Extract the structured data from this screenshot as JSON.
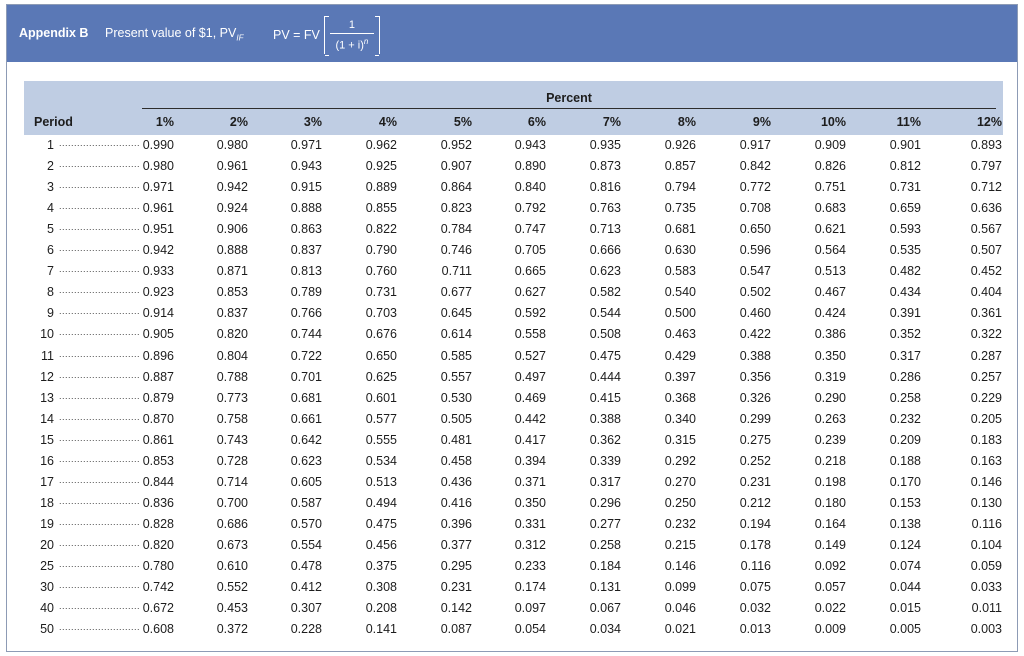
{
  "header": {
    "appendix": "Appendix B",
    "subtitle": "Present value of $1, PV",
    "subtitle_sub": "IF",
    "formula_lhs": "PV = FV",
    "formula_num": "1",
    "formula_den": "(1 + i)",
    "formula_exp": "n",
    "banner_color": "#5a78b6",
    "header_band_color": "#bfcde3"
  },
  "table": {
    "group_label": "Percent",
    "period_label": "Period",
    "columns": [
      "1%",
      "2%",
      "3%",
      "4%",
      "5%",
      "6%",
      "7%",
      "8%",
      "9%",
      "10%",
      "11%",
      "12%"
    ],
    "dots": "..............................",
    "rows": [
      {
        "period": "1",
        "values": [
          "0.990",
          "0.980",
          "0.971",
          "0.962",
          "0.952",
          "0.943",
          "0.935",
          "0.926",
          "0.917",
          "0.909",
          "0.901",
          "0.893"
        ]
      },
      {
        "period": "2",
        "values": [
          "0.980",
          "0.961",
          "0.943",
          "0.925",
          "0.907",
          "0.890",
          "0.873",
          "0.857",
          "0.842",
          "0.826",
          "0.812",
          "0.797"
        ]
      },
      {
        "period": "3",
        "values": [
          "0.971",
          "0.942",
          "0.915",
          "0.889",
          "0.864",
          "0.840",
          "0.816",
          "0.794",
          "0.772",
          "0.751",
          "0.731",
          "0.712"
        ]
      },
      {
        "period": "4",
        "values": [
          "0.961",
          "0.924",
          "0.888",
          "0.855",
          "0.823",
          "0.792",
          "0.763",
          "0.735",
          "0.708",
          "0.683",
          "0.659",
          "0.636"
        ]
      },
      {
        "period": "5",
        "values": [
          "0.951",
          "0.906",
          "0.863",
          "0.822",
          "0.784",
          "0.747",
          "0.713",
          "0.681",
          "0.650",
          "0.621",
          "0.593",
          "0.567"
        ]
      },
      {
        "period": "6",
        "values": [
          "0.942",
          "0.888",
          "0.837",
          "0.790",
          "0.746",
          "0.705",
          "0.666",
          "0.630",
          "0.596",
          "0.564",
          "0.535",
          "0.507"
        ]
      },
      {
        "period": "7",
        "values": [
          "0.933",
          "0.871",
          "0.813",
          "0.760",
          "0.711",
          "0.665",
          "0.623",
          "0.583",
          "0.547",
          "0.513",
          "0.482",
          "0.452"
        ]
      },
      {
        "period": "8",
        "values": [
          "0.923",
          "0.853",
          "0.789",
          "0.731",
          "0.677",
          "0.627",
          "0.582",
          "0.540",
          "0.502",
          "0.467",
          "0.434",
          "0.404"
        ]
      },
      {
        "period": "9",
        "values": [
          "0.914",
          "0.837",
          "0.766",
          "0.703",
          "0.645",
          "0.592",
          "0.544",
          "0.500",
          "0.460",
          "0.424",
          "0.391",
          "0.361"
        ]
      },
      {
        "period": "10",
        "values": [
          "0.905",
          "0.820",
          "0.744",
          "0.676",
          "0.614",
          "0.558",
          "0.508",
          "0.463",
          "0.422",
          "0.386",
          "0.352",
          "0.322"
        ]
      },
      {
        "period": "11",
        "values": [
          "0.896",
          "0.804",
          "0.722",
          "0.650",
          "0.585",
          "0.527",
          "0.475",
          "0.429",
          "0.388",
          "0.350",
          "0.317",
          "0.287"
        ]
      },
      {
        "period": "12",
        "values": [
          "0.887",
          "0.788",
          "0.701",
          "0.625",
          "0.557",
          "0.497",
          "0.444",
          "0.397",
          "0.356",
          "0.319",
          "0.286",
          "0.257"
        ]
      },
      {
        "period": "13",
        "values": [
          "0.879",
          "0.773",
          "0.681",
          "0.601",
          "0.530",
          "0.469",
          "0.415",
          "0.368",
          "0.326",
          "0.290",
          "0.258",
          "0.229"
        ]
      },
      {
        "period": "14",
        "values": [
          "0.870",
          "0.758",
          "0.661",
          "0.577",
          "0.505",
          "0.442",
          "0.388",
          "0.340",
          "0.299",
          "0.263",
          "0.232",
          "0.205"
        ]
      },
      {
        "period": "15",
        "values": [
          "0.861",
          "0.743",
          "0.642",
          "0.555",
          "0.481",
          "0.417",
          "0.362",
          "0.315",
          "0.275",
          "0.239",
          "0.209",
          "0.183"
        ]
      },
      {
        "period": "16",
        "values": [
          "0.853",
          "0.728",
          "0.623",
          "0.534",
          "0.458",
          "0.394",
          "0.339",
          "0.292",
          "0.252",
          "0.218",
          "0.188",
          "0.163"
        ]
      },
      {
        "period": "17",
        "values": [
          "0.844",
          "0.714",
          "0.605",
          "0.513",
          "0.436",
          "0.371",
          "0.317",
          "0.270",
          "0.231",
          "0.198",
          "0.170",
          "0.146"
        ]
      },
      {
        "period": "18",
        "values": [
          "0.836",
          "0.700",
          "0.587",
          "0.494",
          "0.416",
          "0.350",
          "0.296",
          "0.250",
          "0.212",
          "0.180",
          "0.153",
          "0.130"
        ]
      },
      {
        "period": "19",
        "values": [
          "0.828",
          "0.686",
          "0.570",
          "0.475",
          "0.396",
          "0.331",
          "0.277",
          "0.232",
          "0.194",
          "0.164",
          "0.138",
          "0.116"
        ]
      },
      {
        "period": "20",
        "values": [
          "0.820",
          "0.673",
          "0.554",
          "0.456",
          "0.377",
          "0.312",
          "0.258",
          "0.215",
          "0.178",
          "0.149",
          "0.124",
          "0.104"
        ]
      },
      {
        "period": "25",
        "values": [
          "0.780",
          "0.610",
          "0.478",
          "0.375",
          "0.295",
          "0.233",
          "0.184",
          "0.146",
          "0.116",
          "0.092",
          "0.074",
          "0.059"
        ]
      },
      {
        "period": "30",
        "values": [
          "0.742",
          "0.552",
          "0.412",
          "0.308",
          "0.231",
          "0.174",
          "0.131",
          "0.099",
          "0.075",
          "0.057",
          "0.044",
          "0.033"
        ]
      },
      {
        "period": "40",
        "values": [
          "0.672",
          "0.453",
          "0.307",
          "0.208",
          "0.142",
          "0.097",
          "0.067",
          "0.046",
          "0.032",
          "0.022",
          "0.015",
          "0.011"
        ]
      },
      {
        "period": "50",
        "values": [
          "0.608",
          "0.372",
          "0.228",
          "0.141",
          "0.087",
          "0.054",
          "0.034",
          "0.021",
          "0.013",
          "0.009",
          "0.005",
          "0.003"
        ]
      }
    ]
  }
}
